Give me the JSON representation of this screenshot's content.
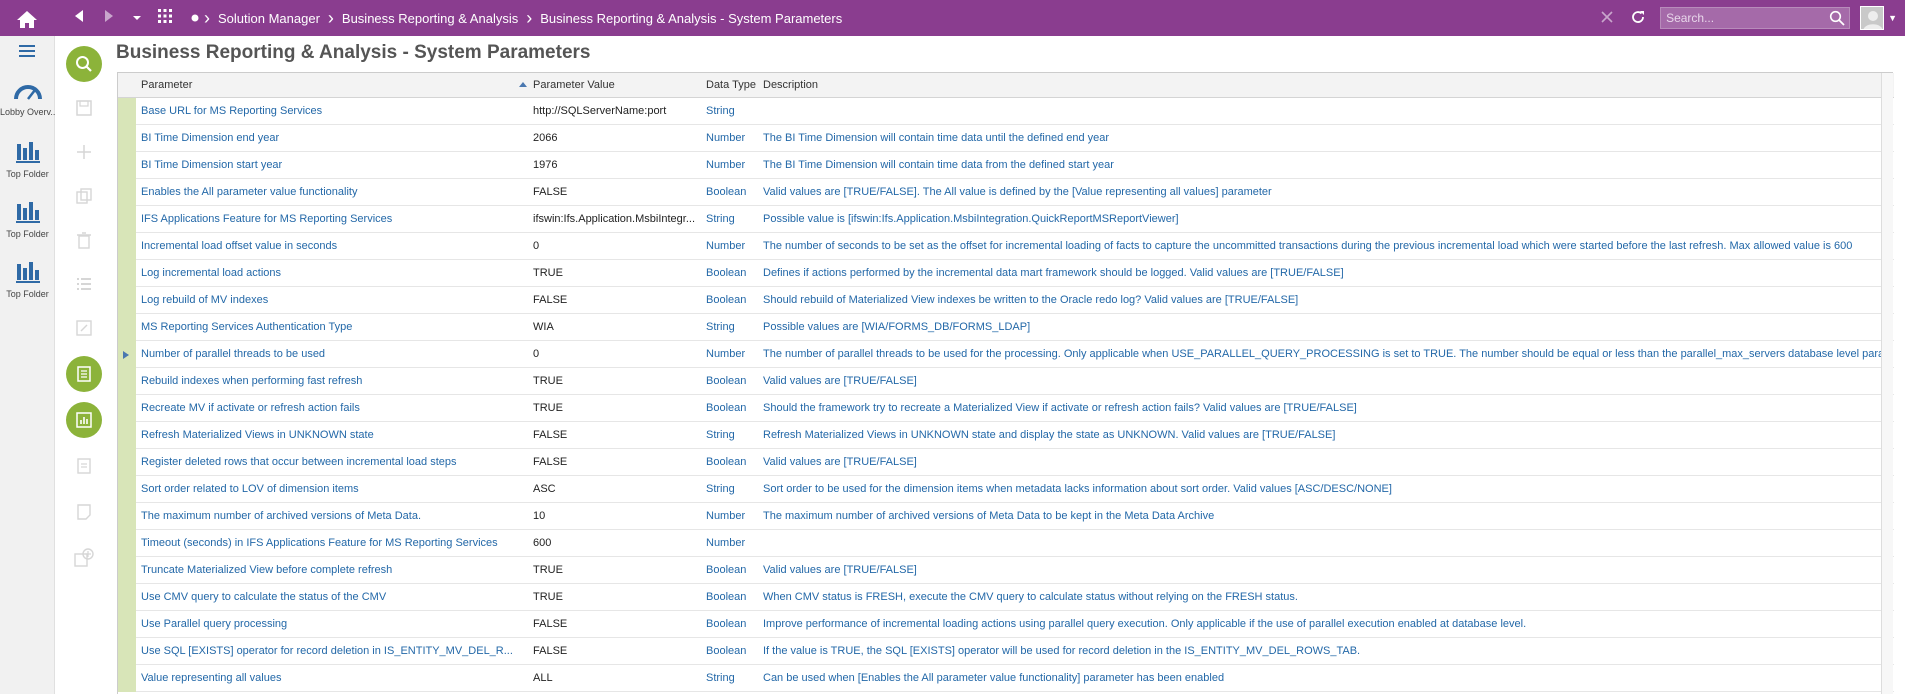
{
  "topbar": {
    "breadcrumbs": [
      "Solution Manager",
      "Business Reporting & Analysis",
      "Business Reporting & Analysis - System Parameters"
    ],
    "search_placeholder": "Search...",
    "accent_color": "#8a3d8f"
  },
  "sidebar": {
    "items": [
      {
        "label": "Lobby Overv...",
        "icon": "gauge-icon"
      },
      {
        "label": "Top Folder",
        "icon": "bar-chart-icon"
      },
      {
        "label": "Top Folder",
        "icon": "bar-chart-icon"
      },
      {
        "label": "Top Folder",
        "icon": "bar-chart-icon"
      }
    ]
  },
  "page": {
    "title": "Business Reporting & Analysis - System Parameters"
  },
  "table": {
    "columns": [
      "Parameter",
      "Parameter Value",
      "Data Type",
      "Description"
    ],
    "sorted_column": "Parameter Value",
    "sort_direction": "asc",
    "selected_row": 9,
    "rows": [
      {
        "parameter": "Base URL for MS Reporting Services",
        "value": "http://SQLServerName:port",
        "type": "String",
        "description": ""
      },
      {
        "parameter": "BI Time Dimension end year",
        "value": "2066",
        "type": "Number",
        "description": "The BI Time Dimension will contain time data until the defined end year"
      },
      {
        "parameter": "BI Time Dimension start year",
        "value": "1976",
        "type": "Number",
        "description": "The BI Time Dimension will contain time data from the defined start year"
      },
      {
        "parameter": "Enables the All parameter value functionality",
        "value": "FALSE",
        "type": "Boolean",
        "description": "Valid values are [TRUE/FALSE]. The All value is defined by the [Value representing all values] parameter"
      },
      {
        "parameter": "IFS Applications Feature for MS Reporting Services",
        "value": "ifswin:Ifs.Application.MsbiIntegr...",
        "type": "String",
        "description": "Possible value is [ifswin:Ifs.Application.MsbiIntegration.QuickReportMSReportViewer]"
      },
      {
        "parameter": "Incremental load offset value in seconds",
        "value": "0",
        "type": "Number",
        "description": "The number of seconds to be set as the offset for incremental loading of facts to capture the uncommitted transactions during the previous incremental load which were started before the last refresh. Max allowed value is 600"
      },
      {
        "parameter": "Log incremental load actions",
        "value": "TRUE",
        "type": "Boolean",
        "description": "Defines if actions performed by the incremental data mart framework should be logged.  Valid values are [TRUE/FALSE]"
      },
      {
        "parameter": "Log rebuild of MV indexes",
        "value": "FALSE",
        "type": "Boolean",
        "description": "Should rebuild of Materialized View indexes be written to the Oracle redo log?  Valid values are [TRUE/FALSE]"
      },
      {
        "parameter": "MS Reporting Services Authentication Type",
        "value": "WIA",
        "type": "String",
        "description": "Possible values are [WIA/FORMS_DB/FORMS_LDAP]"
      },
      {
        "parameter": "Number of parallel threads to be used",
        "value": "0",
        "type": "Number",
        "description": "The number of parallel threads to be used for the processing. Only applicable when USE_PARALLEL_QUERY_PROCESSING is set to TRUE. The number should be equal or less than the parallel_max_servers database level parameter."
      },
      {
        "parameter": "Rebuild indexes when performing fast refresh",
        "value": "TRUE",
        "type": "Boolean",
        "description": "Valid values are [TRUE/FALSE]"
      },
      {
        "parameter": "Recreate MV if activate or refresh action fails",
        "value": "TRUE",
        "type": "Boolean",
        "description": "Should the framework try to recreate a Materialized View if activate or refresh action fails?  Valid values are [TRUE/FALSE]"
      },
      {
        "parameter": "Refresh Materialized Views in UNKNOWN state",
        "value": "FALSE",
        "type": "String",
        "description": "Refresh Materialized Views in UNKNOWN state and display the state as UNKNOWN.  Valid values are [TRUE/FALSE]"
      },
      {
        "parameter": "Register deleted rows that occur between incremental load steps",
        "value": "FALSE",
        "type": "Boolean",
        "description": "Valid values are [TRUE/FALSE]"
      },
      {
        "parameter": "Sort order related to LOV of dimension items",
        "value": "ASC",
        "type": "String",
        "description": "Sort order to be used for the dimension items when metadata lacks information about sort order. Valid values [ASC/DESC/NONE]"
      },
      {
        "parameter": "The maximum number of archived versions of Meta Data.",
        "value": "10",
        "type": "Number",
        "description": "The maximum number of archived versions of Meta Data to be kept in the Meta Data Archive"
      },
      {
        "parameter": "Timeout (seconds) in IFS Applications Feature for MS Reporting Services",
        "value": "600",
        "type": "Number",
        "description": ""
      },
      {
        "parameter": "Truncate Materialized View before complete refresh",
        "value": "TRUE",
        "type": "Boolean",
        "description": "Valid values are [TRUE/FALSE]"
      },
      {
        "parameter": "Use CMV query to calculate the status of the CMV",
        "value": "TRUE",
        "type": "Boolean",
        "description": "When CMV status is FRESH, execute the CMV query to calculate status without relying on the FRESH status."
      },
      {
        "parameter": "Use Parallel query processing",
        "value": "FALSE",
        "type": "Boolean",
        "description": "Improve performance of incremental loading actions using parallel query execution. Only applicable if the use of parallel execution enabled at database level."
      },
      {
        "parameter": "Use SQL [EXISTS] operator  for record deletion in IS_ENTITY_MV_DEL_R...",
        "value": "FALSE",
        "type": "Boolean",
        "description": "If the value is TRUE, the SQL [EXISTS] operator will be used for record deletion in the IS_ENTITY_MV_DEL_ROWS_TAB."
      },
      {
        "parameter": "Value representing all values",
        "value": "ALL",
        "type": "String",
        "description": "Can be used when [Enables the All parameter value functionality] parameter has been enabled"
      }
    ]
  }
}
